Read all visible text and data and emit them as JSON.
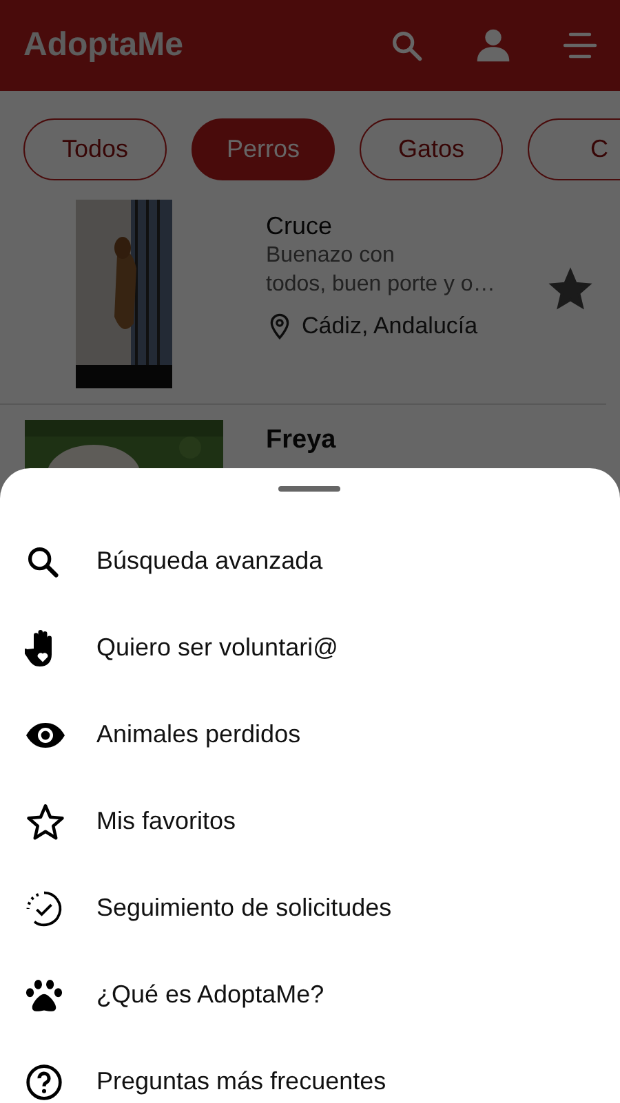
{
  "app_bar": {
    "title": "AdoptaMe"
  },
  "filters": [
    {
      "label": "Todos",
      "selected": false
    },
    {
      "label": "Perros",
      "selected": true
    },
    {
      "label": "Gatos",
      "selected": false
    },
    {
      "label": "C",
      "selected": false
    }
  ],
  "pets": [
    {
      "breed": "Cruce",
      "description_lines": [
        "Buenazo con",
        "todos, buen porte y o…"
      ],
      "location": "Cádiz, Andalucía",
      "favorite": true
    },
    {
      "name": "Freya"
    }
  ],
  "menu": [
    {
      "kind": "search",
      "label": "Búsqueda avanzada"
    },
    {
      "kind": "hand",
      "label": "Quiero ser voluntari@"
    },
    {
      "kind": "eye",
      "label": "Animales perdidos"
    },
    {
      "kind": "star",
      "label": "Mis favoritos"
    },
    {
      "kind": "progress",
      "label": "Seguimiento de solicitudes"
    },
    {
      "kind": "paw",
      "label": "¿Qué es AdoptaMe?"
    },
    {
      "kind": "help",
      "label": "Preguntas más frecuentes"
    }
  ]
}
